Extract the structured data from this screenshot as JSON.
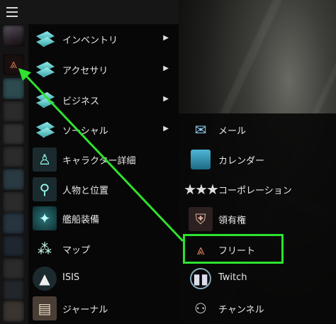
{
  "main_menu": {
    "items": [
      {
        "label": "インベントリ",
        "icon": "inventory-icon",
        "submenu": true
      },
      {
        "label": "アクセサリ",
        "icon": "accessories-icon",
        "submenu": true
      },
      {
        "label": "ビジネス",
        "icon": "business-icon",
        "submenu": true
      },
      {
        "label": "ソーシャル",
        "icon": "social-icon",
        "submenu": true
      },
      {
        "label": "キャラクター詳細",
        "icon": "character-sheet-icon",
        "submenu": false
      },
      {
        "label": "人物と位置",
        "icon": "people-and-places-icon",
        "submenu": false
      },
      {
        "label": "艦船装備",
        "icon": "fitting-icon",
        "submenu": false
      },
      {
        "label": "マップ",
        "icon": "map-icon",
        "submenu": false
      },
      {
        "label": "ISIS",
        "icon": "isis-icon",
        "submenu": false
      },
      {
        "label": "ジャーナル",
        "icon": "journal-icon",
        "submenu": false
      }
    ]
  },
  "social_submenu": {
    "items": [
      {
        "label": "メール",
        "icon": "mail-icon"
      },
      {
        "label": "カレンダー",
        "icon": "calendar-icon"
      },
      {
        "label": "コーポレーション",
        "icon": "corporation-icon"
      },
      {
        "label": "領有権",
        "icon": "sovereignty-icon"
      },
      {
        "label": "フリート",
        "icon": "fleet-icon"
      },
      {
        "label": "Twitch",
        "icon": "twitch-icon"
      },
      {
        "label": "チャンネル",
        "icon": "channels-icon"
      }
    ]
  },
  "annotation": {
    "highlight_color": "#2ee22e",
    "highlighted_item": "フリート"
  }
}
